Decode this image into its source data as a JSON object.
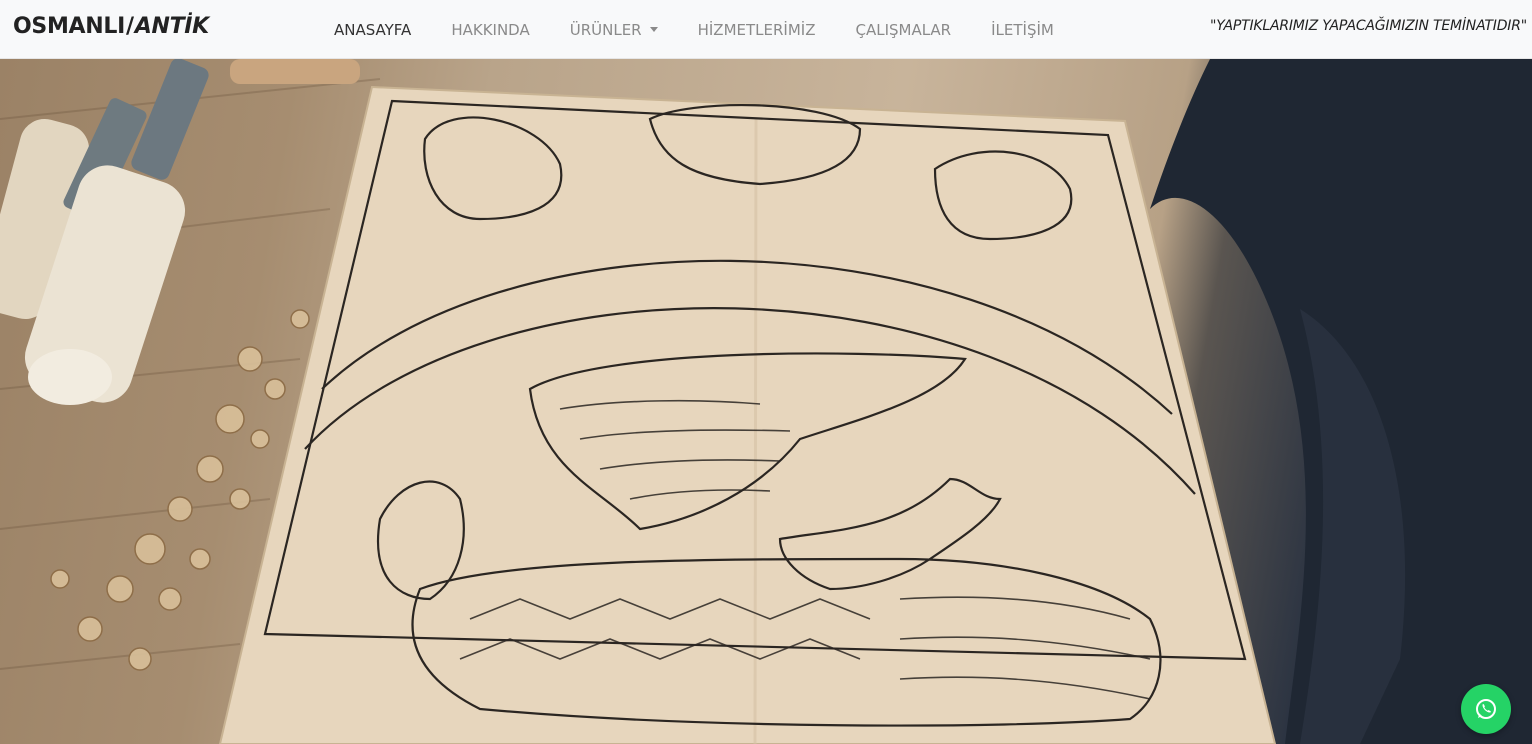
{
  "brand": {
    "part1": "OSMANLI",
    "separator": "/",
    "part2": "ANTİK"
  },
  "nav": {
    "items": [
      {
        "label": "ANASAYFA",
        "active": true
      },
      {
        "label": "HAKKINDA",
        "active": false
      },
      {
        "label": "ÜRÜNLER",
        "active": false,
        "dropdown": true
      },
      {
        "label": "HİZMETLERİMİZ",
        "active": false
      },
      {
        "label": "ÇALIŞMALAR",
        "active": false
      },
      {
        "label": "İLETİŞİM",
        "active": false
      }
    ]
  },
  "motto": "\"YAPTIKLARIMIZ YAPACAĞIMIZIN TEMİNATIDIR\"",
  "hero": {
    "image": "wood-carving-eagle-photo"
  },
  "whatsapp": {
    "icon": "whatsapp-icon",
    "color": "#25d366"
  },
  "colors": {
    "navbar_bg": "#f8f9fa",
    "nav_active": "#333333",
    "nav_inactive": "#8a8a8a"
  }
}
